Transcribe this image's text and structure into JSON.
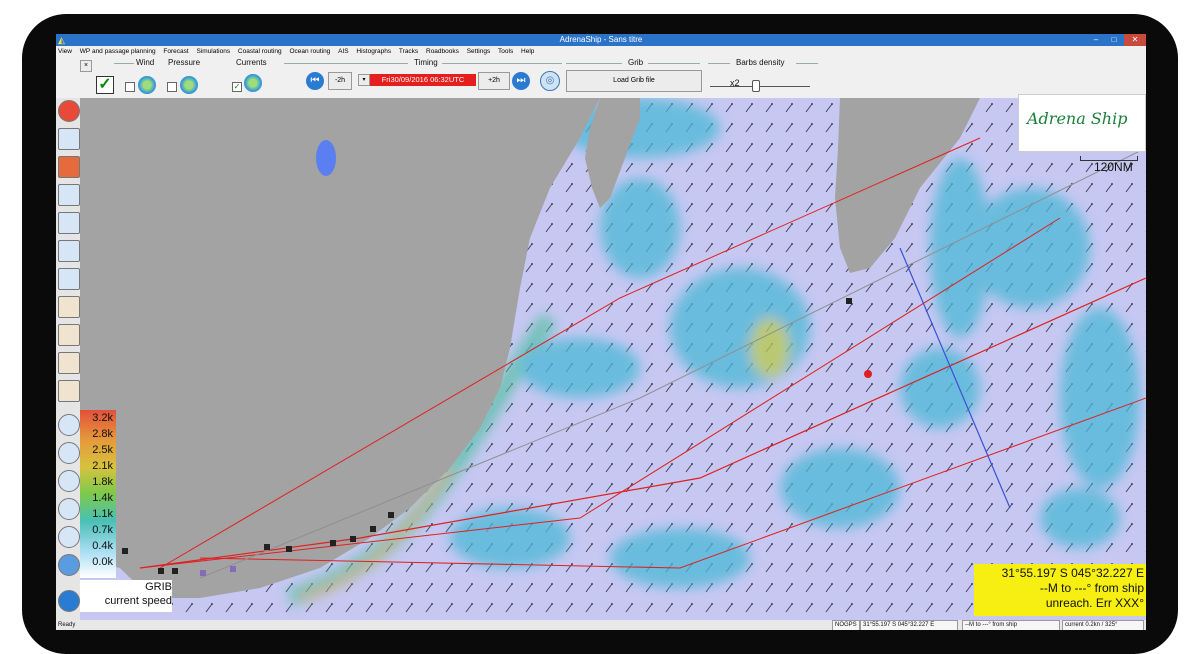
{
  "window": {
    "title": "AdrenaShip - Sans titre",
    "minimize": "–",
    "maximize": "□",
    "close": "✕"
  },
  "menu": [
    "View",
    "WP and passage planning",
    "Forecast",
    "Simulations",
    "Coastal routing",
    "Ocean routing",
    "AIS",
    "Histographs",
    "Tracks",
    "Roadbooks",
    "Settings",
    "Tools",
    "Help"
  ],
  "toolbar": {
    "close_x": "×",
    "wind_label": "Wind",
    "pressure_label": "Pressure",
    "currents_label": "Currents",
    "timing_label": "Timing",
    "minus_label": "-2h",
    "date_value": "Fri30/09/2016 06:32UTC",
    "plus_label": "+2h",
    "grib_label": "Grib",
    "load_grib_label": "Load Grib file",
    "barbs_label": "Barbs density",
    "barbs_value": "x2",
    "currents_checked": true,
    "wind_checked": false,
    "pressure_checked": false
  },
  "legend": {
    "ticks": [
      "3.2k",
      "2.8k",
      "2.5k",
      "2.1k",
      "1.8k",
      "1.4k",
      "1.1k",
      "0.7k",
      "0.4k",
      "0.0k"
    ],
    "caption_line1": "GRIB",
    "caption_line2": "current speed"
  },
  "logo": {
    "text": "Adrena Ship"
  },
  "scale": {
    "label": "120NM"
  },
  "position": {
    "line1": "31°55.197 S  045°32.227 E",
    "line2": "--M to ---° from ship",
    "line3": "unreach. Err XXX°"
  },
  "status": {
    "ready": "Ready",
    "gps": "NOGPS",
    "coords": "31°55.197 S  045°32.227 E",
    "bearing": "--M to ---° from ship",
    "current": "current 0.2kn / 325°"
  },
  "colors": {
    "sea": "#c6c8f2",
    "land": "#a3a3a3",
    "route": "#e02020",
    "date_bg": "#e51e1e",
    "position_bg": "#f6ef11"
  }
}
